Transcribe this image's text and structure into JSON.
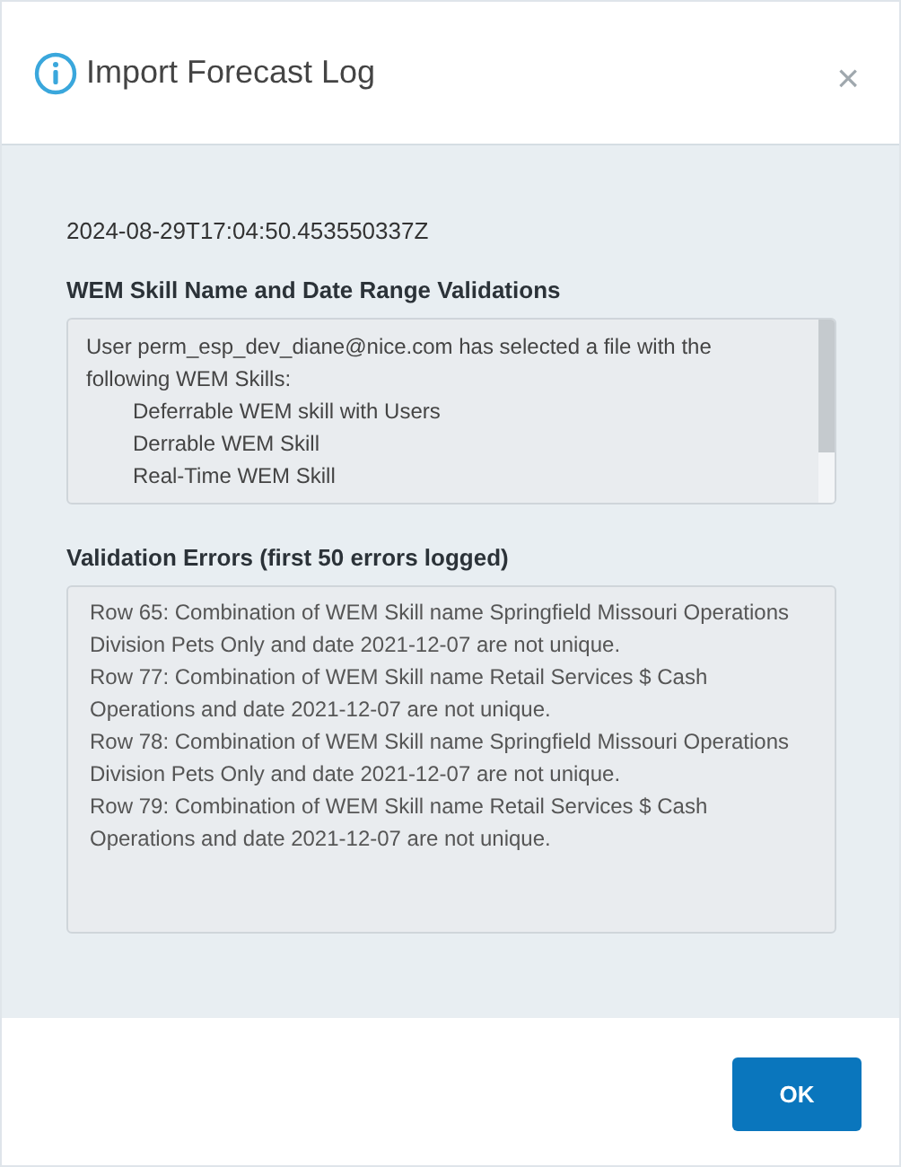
{
  "dialog": {
    "title": "Import Forecast Log",
    "close": "×"
  },
  "timestamp": "2024-08-29T17:04:50.453550337Z",
  "skills_section": {
    "heading": "WEM Skill Name and Date Range Validations",
    "intro": "User perm_esp_dev_diane@nice.com has selected a file with the following WEM Skills:",
    "skills": [
      "Deferrable WEM skill with Users",
      "Derrable WEM Skill",
      "Real-Time WEM Skill"
    ]
  },
  "errors_section": {
    "heading": "Validation Errors (first 50 errors logged)",
    "errors": [
      "Row 65: Combination of WEM Skill name Springfield Missouri Operations Division Pets Only and date 2021-12-07 are not unique.",
      "Row 77: Combination of WEM Skill name Retail Services $ Cash Operations and date 2021-12-07 are not unique.",
      "Row 78: Combination of WEM Skill name Springfield Missouri Operations Division Pets Only and date 2021-12-07 are not unique.",
      "Row 79: Combination of WEM Skill name Retail Services $ Cash Operations and date 2021-12-07 are not unique."
    ]
  },
  "buttons": [
    "OK"
  ]
}
